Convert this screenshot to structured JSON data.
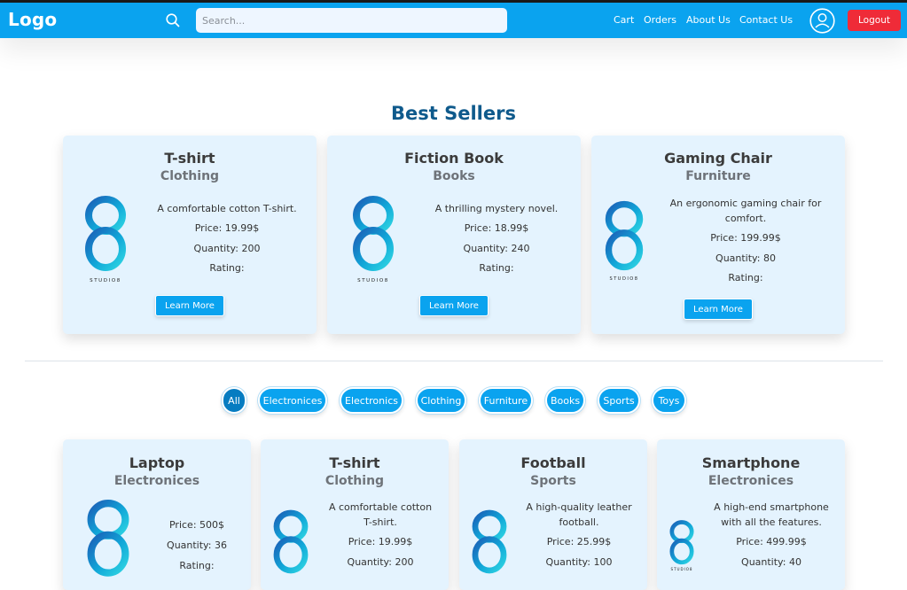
{
  "navbar": {
    "logo": "Logo",
    "search_placeholder": "Search...",
    "links": [
      "Cart",
      "Orders",
      "About Us",
      "Contact Us"
    ],
    "logout_label": "Logout"
  },
  "colors": {
    "navbar": "#0aa3ef",
    "title": "#0f5a8c",
    "card_bg": "#e4f3fe",
    "logout": "#ef2b38"
  },
  "best_sellers": {
    "title": "Best Sellers",
    "items": [
      {
        "name": "T-shirt",
        "category": "Clothing",
        "description": "A comfortable cotton T-shirt.",
        "price": "Price: 19.99$",
        "quantity": "Quantity: 200",
        "rating": "Rating:",
        "button": "Learn More",
        "image_caption": "STUDIO8"
      },
      {
        "name": "Fiction Book",
        "category": "Books",
        "description": "A thrilling mystery novel.",
        "price": "Price: 18.99$",
        "quantity": "Quantity: 240",
        "rating": "Rating:",
        "button": "Learn More",
        "image_caption": "STUDIO8"
      },
      {
        "name": "Gaming Chair",
        "category": "Furniture",
        "description_lines": [
          "An ergonomic gaming chair for",
          "comfort."
        ],
        "price": "Price: 199.99$",
        "quantity": "Quantity: 80",
        "rating": "Rating:",
        "button": "Learn More",
        "image_caption": "STUDIO8"
      }
    ]
  },
  "filters": [
    "All",
    "Electronices",
    "Electronics",
    "Clothing",
    "Furniture",
    "Books",
    "Sports",
    "Toys"
  ],
  "products": [
    {
      "name": "Laptop",
      "category": "Electronices",
      "price": "Price: 500$",
      "quantity": "Quantity: 36",
      "rating": "Rating:"
    },
    {
      "name": "T-shirt",
      "category": "Clothing",
      "description_lines": [
        "A comfortable cotton",
        "T-shirt."
      ],
      "price": "Price: 19.99$",
      "quantity": "Quantity: 200"
    },
    {
      "name": "Football",
      "category": "Sports",
      "description_lines": [
        "A high-quality leather",
        "football."
      ],
      "price": "Price: 25.99$",
      "quantity": "Quantity: 100"
    },
    {
      "name": "Smartphone",
      "category": "Electronices",
      "description_lines": [
        "A high-end smartphone",
        "with all the features."
      ],
      "price": "Price: 499.99$",
      "quantity": "Quantity: 40",
      "image_caption": "STUDIO8"
    }
  ]
}
